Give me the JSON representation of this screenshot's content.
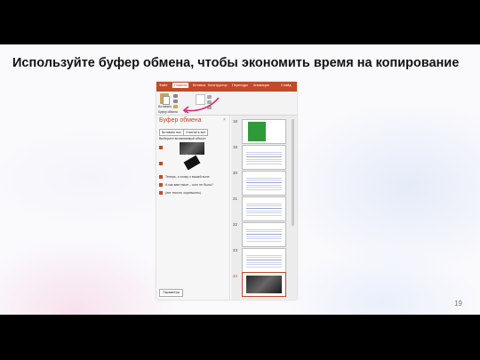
{
  "slide": {
    "title": "Используйте буфер обмена, чтобы экономить время на копирование",
    "page_number": "19"
  },
  "app": {
    "ribbon_tabs": [
      "Файл",
      "Главная",
      "Вставка",
      "Конструктор",
      "Переходы",
      "Анимация",
      "Слайд"
    ],
    "active_tab": "Главная",
    "paste_label": "Вставить",
    "clipboard_group_label": "Буфер обмена",
    "brand_color": "#c14a2a"
  },
  "clipboard_pane": {
    "title": "Буфер обмена",
    "close": "×",
    "paste_all": "Вставить все",
    "clear_all": "Очистить все",
    "hint": "Выберите вставляемый объект:",
    "items": [
      "Теперь, к слову о вашей воле",
      "А как вам такое – кого не было?",
      "(нет текста: скриншоты)"
    ],
    "params_button": "Параметры"
  },
  "slides_panel": {
    "numbers": [
      "18",
      "19",
      "20",
      "21",
      "22",
      "23",
      "24"
    ]
  }
}
